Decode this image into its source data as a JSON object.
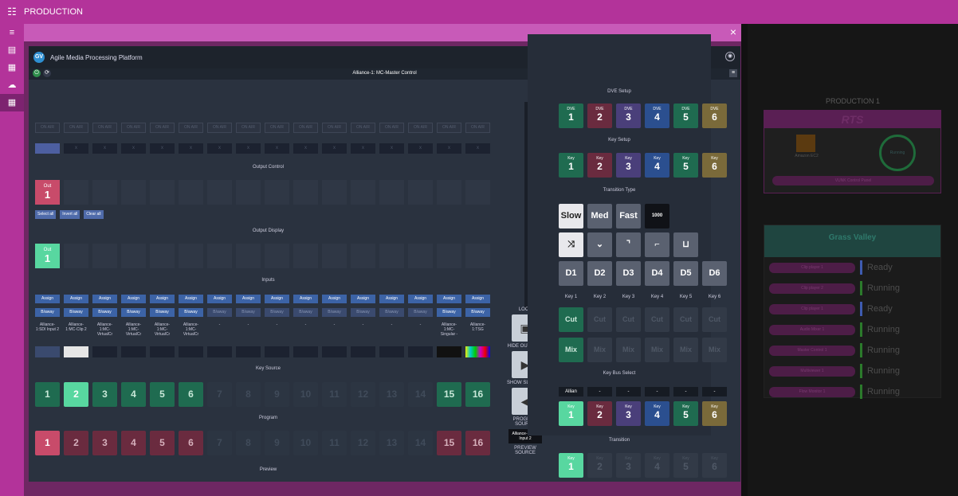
{
  "topbar": {
    "title": "PRODUCTION",
    "grid_icon": "grid-icon"
  },
  "app": {
    "name": "Agile Media Processing Platform",
    "logo": "GV",
    "control_title": "Alliance-1: MC-Master Control"
  },
  "onair_label": "ON AIR",
  "onair_count": 16,
  "output_control": {
    "label": "Output Control",
    "out_label": "Out",
    "out_num": "1",
    "buttons": [
      "Select all",
      "Invert all",
      "Clear all"
    ]
  },
  "output_display": {
    "label": "Output Display",
    "out_label": "Out",
    "out_num": "1"
  },
  "inputs": {
    "label": "Inputs",
    "assign": "Assign",
    "baway": "B/away",
    "names": [
      "Alliance-1:SDI Input 2",
      "Alliance-1:MC-Clip 2",
      "Alliance-1:MC-VirtualCr",
      "Alliance-1:MC-VirtualCr",
      "Alliance-1:MC-VirtualCr",
      "Alliance-1:MC-VirtualCr",
      "-",
      "-",
      "-",
      "-",
      "-",
      "-",
      "-",
      "-",
      "Alliance-1:MC-Singular -",
      "Alliance-1:TSG"
    ]
  },
  "key_source": {
    "label": "Key Source",
    "nums": [
      "1",
      "2",
      "3",
      "4",
      "5",
      "6",
      "7",
      "8",
      "9",
      "10",
      "11",
      "12",
      "13",
      "14",
      "15",
      "16"
    ]
  },
  "program": {
    "label": "Program"
  },
  "preview": {
    "label": "Preview"
  },
  "mid": {
    "lock": "LOCK",
    "hide_outputs": "HIDE OUTPUTS",
    "show_sliders": "SHOW SLIDERS",
    "program_source": "PROGRAM SOURCE",
    "program_source_value": "Alliance-1: SDI Input 2",
    "preview_source": "PREVIEW SOURCE"
  },
  "dve": {
    "label": "DVE Setup",
    "prefix": "DVE",
    "nums": [
      "1",
      "2",
      "3",
      "4",
      "5",
      "6"
    ]
  },
  "key_setup": {
    "label": "Key Setup",
    "prefix": "Key",
    "nums": [
      "1",
      "2",
      "3",
      "4",
      "5",
      "6"
    ]
  },
  "transition_type": {
    "label": "Transition Type",
    "speeds": [
      "Slow",
      "Med",
      "Fast"
    ],
    "frames": "1000",
    "d": [
      "D1",
      "D2",
      "D3",
      "D4",
      "D5",
      "D6"
    ]
  },
  "keys": {
    "labels": [
      "Key 1",
      "Key 2",
      "Key 3",
      "Key 4",
      "Key 5",
      "Key 6"
    ],
    "cut": "Cut",
    "mix": "Mix"
  },
  "key_bus": {
    "label": "Key Bus Select",
    "values": [
      "Allian",
      "-",
      "-",
      "-",
      "-",
      "-"
    ],
    "prefix": "Key",
    "nums": [
      "1",
      "2",
      "3",
      "4",
      "5",
      "6"
    ]
  },
  "transition": {
    "label": "Transition",
    "prefix": "Key",
    "nums": [
      "1",
      "2",
      "3",
      "4",
      "5",
      "6"
    ]
  },
  "production": {
    "title": "PRODUCTION 1",
    "rts": "RTS",
    "amazon": "Amazon EC2",
    "running": "Running",
    "vunk": "VUNK Control Panel",
    "gv": "Grass Valley",
    "items": [
      {
        "label": "Clip player 1",
        "status": "Ready",
        "color": "#3e5bb0"
      },
      {
        "label": "Clip player 2",
        "status": "Running",
        "color": "#2b7a2b"
      },
      {
        "label": "Clip player 1",
        "status": "Ready",
        "color": "#3e5bb0"
      },
      {
        "label": "Audio Mixer 1",
        "status": "Running",
        "color": "#2b7a2b"
      },
      {
        "label": "Master Control 1",
        "status": "Running",
        "color": "#2b7a2b"
      },
      {
        "label": "Multiviewer 1",
        "status": "Running",
        "color": "#2b7a2b"
      },
      {
        "label": "Flow Monitor 1",
        "status": "Running",
        "color": "#2b7a2b"
      }
    ]
  }
}
